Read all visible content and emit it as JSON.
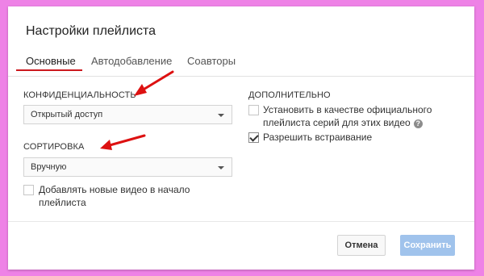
{
  "dialog": {
    "title": "Настройки плейлиста",
    "tabs": [
      {
        "label": "Основные",
        "active": true
      },
      {
        "label": "Автодобавление",
        "active": false
      },
      {
        "label": "Соавторы",
        "active": false
      }
    ]
  },
  "left": {
    "privacy": {
      "heading": "КОНФИДЕНЦИАЛЬНОСТЬ",
      "selected": "Открытый доступ"
    },
    "sorting": {
      "heading": "СОРТИРОВКА",
      "selected": "Вручную"
    },
    "add_to_top": {
      "line1": "Добавлять новые видео в начало",
      "line2": "плейлиста",
      "checked": false
    }
  },
  "right": {
    "heading": "ДОПОЛНИТЕЛЬНО",
    "official_series": {
      "line1": "Установить в качестве официального",
      "line2": "плейлиста серий для этих видео",
      "checked": false,
      "help_glyph": "?"
    },
    "allow_embed": {
      "label": "Разрешить встраивание",
      "checked": true
    }
  },
  "footer": {
    "cancel_label": "Отмена",
    "save_label": "Сохранить"
  },
  "colors": {
    "background": "#ee82e6",
    "tab_active_underline": "#cc181e",
    "save_button": "#a0c3ec",
    "annotation_arrow": "#dd1111"
  },
  "icons": {
    "dropdown": "chevron-down-icon",
    "help": "help-icon",
    "check": "checkmark-icon",
    "annotation": "red-arrow-icon"
  }
}
